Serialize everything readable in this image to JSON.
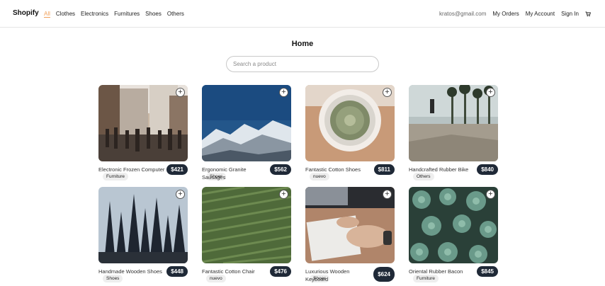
{
  "nav": {
    "brand": "Shopify",
    "categories": [
      "All",
      "Clothes",
      "Electronics",
      "Furnitures",
      "Shoes",
      "Others"
    ],
    "email": "kratos@gmail.com",
    "my_orders": "My Orders",
    "my_account": "My Account",
    "sign_in": "Sign In",
    "cart_icon": "shopping-cart-icon",
    "active_color": "#f0a05a"
  },
  "page": {
    "title": "Home"
  },
  "search": {
    "placeholder": "Search a product",
    "value": ""
  },
  "products": [
    {
      "name": "Electronic Frozen Computer",
      "price": "$421",
      "category": "Furniture",
      "image": "city-street-crowd"
    },
    {
      "name": "Ergonomic Granite Sausages",
      "price": "$562",
      "category": "Shoes",
      "image": "snowy-mountains"
    },
    {
      "name": "Fantastic Cotton Shoes",
      "price": "$811",
      "category": "nuevo",
      "image": "cactus-pot"
    },
    {
      "name": "Handcrafted Rubber Bike",
      "price": "$840",
      "category": "Others",
      "image": "skatepark-palms"
    },
    {
      "name": "Handmade Wooden Shoes",
      "price": "$448",
      "category": "Shoes",
      "image": "pine-forest"
    },
    {
      "name": "Fantastic Cotton Chair",
      "price": "$476",
      "category": "nuevo",
      "image": "green-field"
    },
    {
      "name": "Luxurious Wooden Keyboard",
      "price": "$624",
      "category": "Shoes",
      "image": "hands-writing-desk"
    },
    {
      "name": "Oriental Rubber Bacon",
      "price": "$845",
      "category": "Furniture",
      "image": "succulents"
    }
  ],
  "price_badge_color": "#1f2937"
}
